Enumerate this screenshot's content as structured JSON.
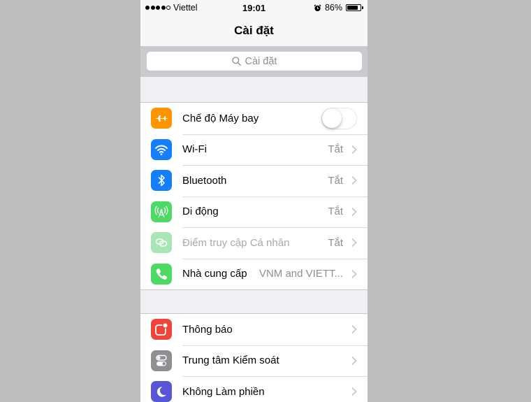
{
  "status_bar": {
    "signal_strength": "4 of 5",
    "carrier": "Viettel",
    "time": "19:01",
    "alarm_icon": "alarm-clock-icon",
    "battery_percent": "86%",
    "battery_level": 0.86
  },
  "nav": {
    "title": "Cài đặt"
  },
  "search": {
    "placeholder": "Cài đặt",
    "icon": "search-icon"
  },
  "sections": [
    {
      "rows": [
        {
          "label": "Chế độ Máy bay",
          "icon": "airplane-icon",
          "color": "#ff9500",
          "control": "toggle",
          "toggle_on": false
        },
        {
          "label": "Wi-Fi",
          "icon": "wifi-icon",
          "color": "#147efb",
          "value": "Tắt"
        },
        {
          "label": "Bluetooth",
          "icon": "bluetooth-icon",
          "color": "#147efb",
          "value": "Tắt"
        },
        {
          "label": "Di động",
          "icon": "cellular-antenna-icon",
          "color": "#4cd964",
          "value": "Tắt"
        },
        {
          "label": "Điểm truy cập Cá nhân",
          "icon": "personal-hotspot-icon",
          "color": "#a8e6b5",
          "value": "Tắt",
          "disabled": true
        },
        {
          "label": "Nhà cung cấp",
          "icon": "phone-icon",
          "color": "#4cd964",
          "value": "VNM and VIETT..."
        }
      ]
    },
    {
      "rows": [
        {
          "label": "Thông báo",
          "icon": "notifications-icon",
          "color": "#f0433a"
        },
        {
          "label": "Trung tâm Kiểm soát",
          "icon": "control-center-icon",
          "color": "#8e8e93"
        },
        {
          "label": "Không Làm phiền",
          "icon": "moon-icon",
          "color": "#5856d6"
        }
      ]
    }
  ]
}
